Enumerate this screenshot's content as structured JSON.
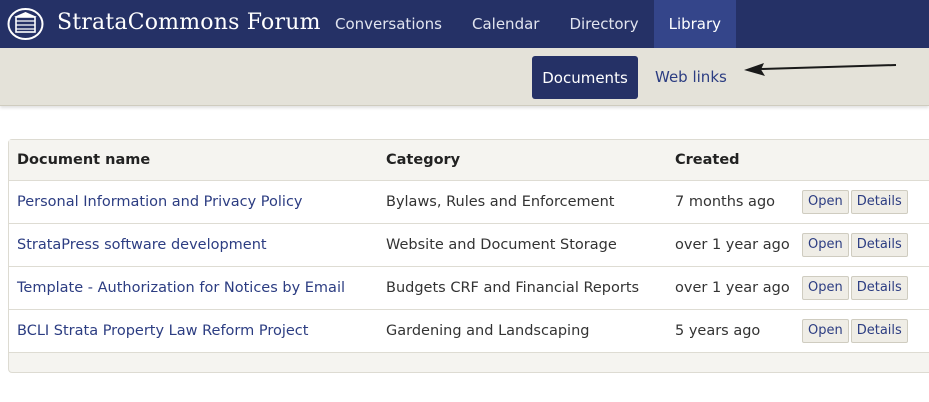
{
  "app": {
    "title": "StrataCommons Forum"
  },
  "nav": {
    "items": [
      {
        "label": "Conversations"
      },
      {
        "label": "Calendar"
      },
      {
        "label": "Directory"
      },
      {
        "label": "Library"
      }
    ],
    "active": "Library"
  },
  "subnav": {
    "documents_label": "Documents",
    "weblinks_label": "Web links"
  },
  "table": {
    "headers": {
      "name": "Document name",
      "category": "Category",
      "created": "Created"
    },
    "rows": [
      {
        "name": "Personal Information and Privacy Policy",
        "category": "Bylaws, Rules and Enforcement",
        "created": "7 months ago",
        "open": "Open",
        "details": "Details"
      },
      {
        "name": "StrataPress software development",
        "category": "Website and Document Storage",
        "created": "over 1 year ago",
        "open": "Open",
        "details": "Details"
      },
      {
        "name": "Template - Authorization for Notices by Email",
        "category": "Budgets CRF and Financial Reports",
        "created": "over 1 year ago",
        "open": "Open",
        "details": "Details"
      },
      {
        "name": "BCLI Strata Property Law Reform Project",
        "category": "Gardening and Landscaping",
        "created": "5 years ago",
        "open": "Open",
        "details": "Details"
      }
    ]
  },
  "colors": {
    "navy": "#253166",
    "active_nav": "#34458a",
    "link": "#2c3d82",
    "subbar": "#e4e2d9"
  },
  "icons": {
    "logo": "building-icon",
    "annotation": "arrow-left-icon"
  }
}
